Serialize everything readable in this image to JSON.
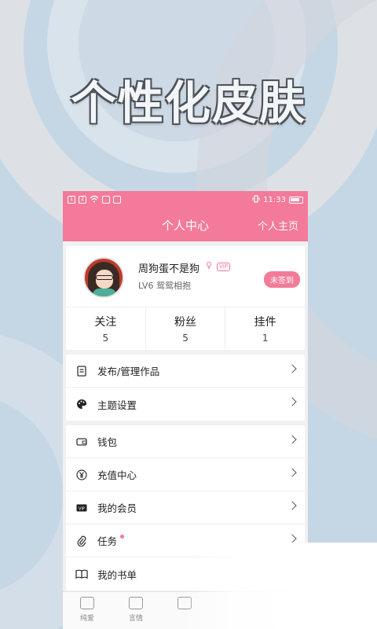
{
  "headline": "个性化皮肤",
  "status_bar": {
    "time": "11:33"
  },
  "nav": {
    "title": "个人中心",
    "right_link": "个人主页"
  },
  "profile": {
    "username": "周狗蛋不是狗",
    "gender_symbol": "♀",
    "vip_badge": "VIP",
    "level": "LV6 鸳鸳相抱",
    "signin_button": "未签到"
  },
  "stats": [
    {
      "label": "关注",
      "value": "5"
    },
    {
      "label": "粉丝",
      "value": "5"
    },
    {
      "label": "挂件",
      "value": "1"
    }
  ],
  "menu_group_1": [
    {
      "label": "发布/管理作品",
      "icon": "document-icon"
    },
    {
      "label": "主题设置",
      "icon": "palette-icon"
    }
  ],
  "menu_group_2": [
    {
      "label": "钱包",
      "icon": "wallet-icon"
    },
    {
      "label": "充值中心",
      "icon": "yen-coin-icon"
    },
    {
      "label": "我的会员",
      "icon": "vip-card-icon"
    },
    {
      "label": "任务",
      "icon": "paperclip-icon",
      "has_notification_dot": true
    },
    {
      "label": "我的书单",
      "icon": "book-icon"
    }
  ],
  "tabbar": [
    {
      "label": "纯爱",
      "icon": "home-icon"
    },
    {
      "label": "言情",
      "icon": "inbox-icon"
    }
  ],
  "colors": {
    "accent": "#f37a98",
    "background": "#c5d6e4"
  }
}
